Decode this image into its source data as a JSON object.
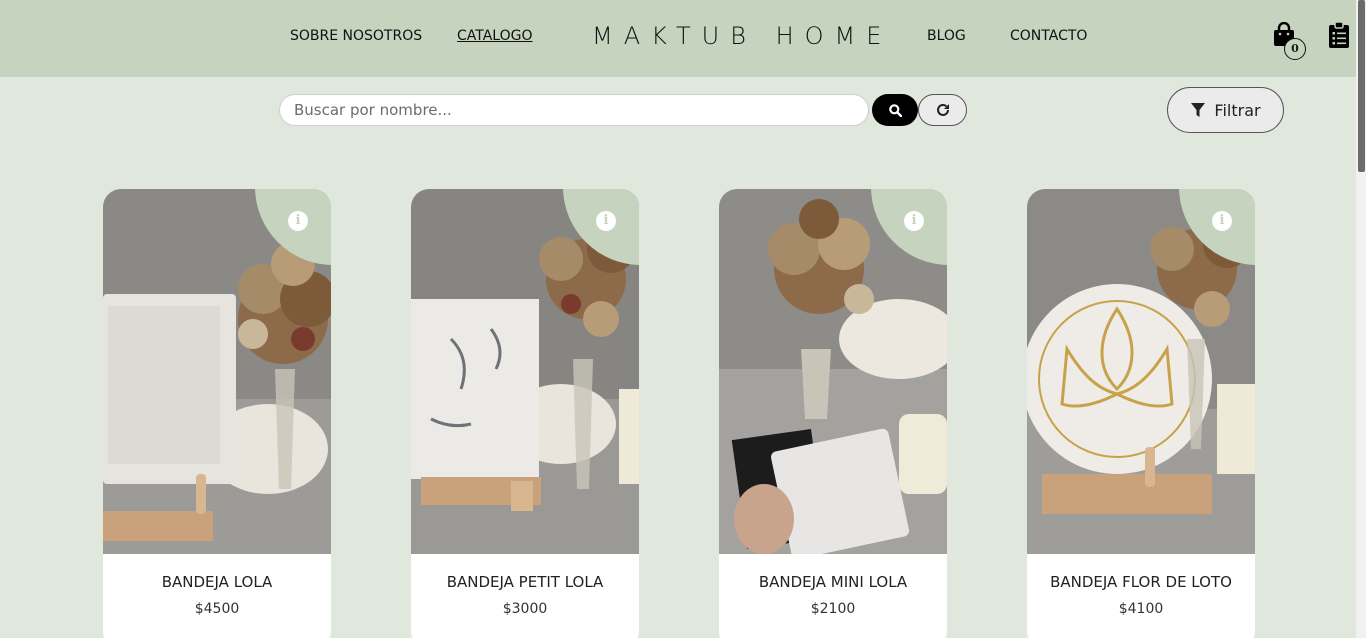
{
  "header": {
    "nav_left": [
      "SOBRE NOSOTROS",
      "CATALOGO"
    ],
    "brand": "MAKTUB HOME",
    "nav_right": [
      "BLOG",
      "CONTACTO"
    ],
    "cart_count": "0",
    "cart_icon": "shopping-bag-icon",
    "orders_icon": "clipboard-list-icon"
  },
  "search": {
    "placeholder": "Buscar por nombre...",
    "search_icon": "search-icon",
    "reset_icon": "redo-icon"
  },
  "filter": {
    "label": "Filtrar",
    "icon": "filter-icon"
  },
  "colors": {
    "header_bg": "#c5d3bf",
    "page_bg": "#e0e7dc",
    "accent": "#000000"
  },
  "products": [
    {
      "name": "BANDEJA LOLA",
      "price": "$4500"
    },
    {
      "name": "BANDEJA PETIT LOLA",
      "price": "$3000"
    },
    {
      "name": "BANDEJA MINI LOLA",
      "price": "$2100"
    },
    {
      "name": "BANDEJA FLOR DE LOTO",
      "price": "$4100"
    }
  ]
}
